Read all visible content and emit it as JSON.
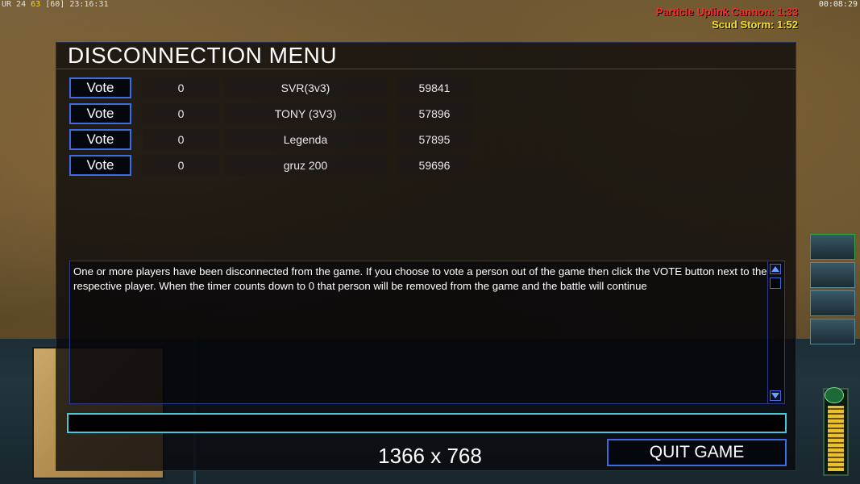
{
  "hud": {
    "top_left_prefix": "UR 24",
    "top_left_fps": "63",
    "top_left_suffix": "[60] 23:16:31",
    "top_right_clock": "00:08:29",
    "timers": [
      {
        "label": "Particle Uplink Cannon: 1:33",
        "color": "#ff2a2a"
      },
      {
        "label": "Scud Storm: 1:52",
        "color": "#f5e02a"
      }
    ]
  },
  "background_hud": {
    "power_level": 0.85
  },
  "dialog": {
    "title": "DISCONNECTION MENU",
    "vote_label": "Vote",
    "players": [
      {
        "votes": "0",
        "name": "SVR(3v3)",
        "id": "59841"
      },
      {
        "votes": "0",
        "name": "TONY (3V3)",
        "id": "57896"
      },
      {
        "votes": "0",
        "name": "Legenda",
        "id": "57895"
      },
      {
        "votes": "0",
        "name": "gruz 200",
        "id": "59696"
      }
    ],
    "message": "One or more players have been disconnected from the game. If you choose to vote a person out of the game then click the VOTE button next to the respective player. When the timer counts down to 0 that person will be removed from the game and the battle will continue",
    "chat_value": "",
    "resolution": "1366 x 768",
    "quit_label": "QUIT GAME"
  },
  "colors": {
    "button_border": "#3a6ee0",
    "chat_border": "#49c6d8"
  },
  "icons": {
    "scroll_up": "triangle-up-icon",
    "scroll_down": "triangle-down-icon"
  }
}
